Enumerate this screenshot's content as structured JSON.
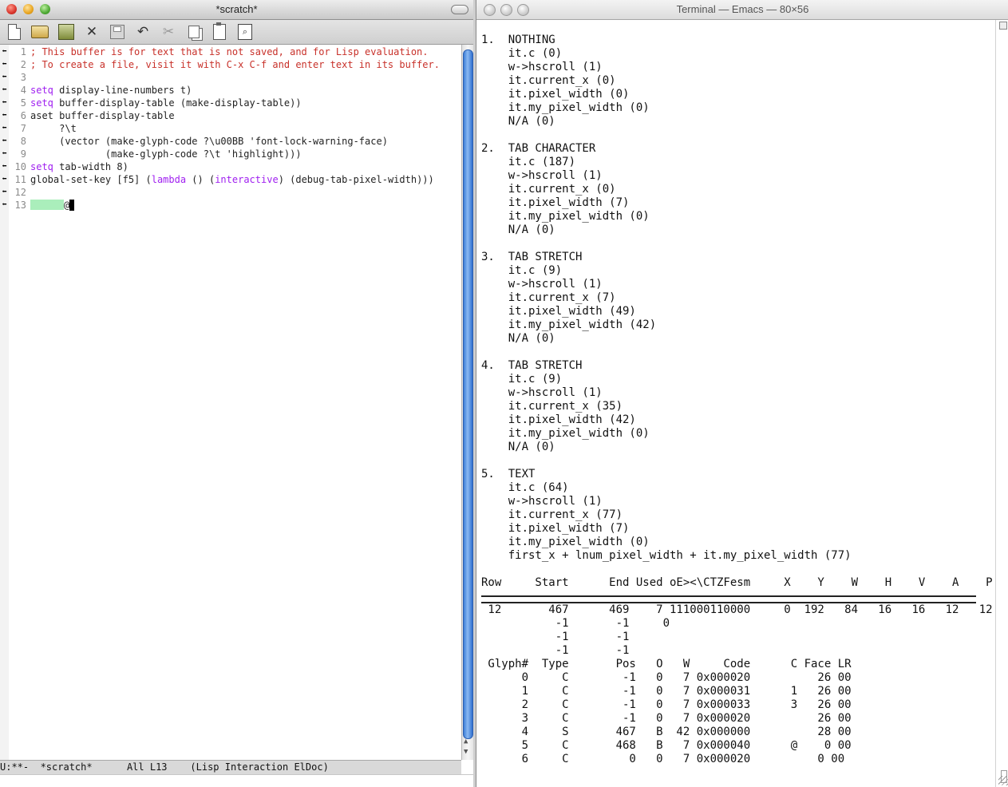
{
  "emacs": {
    "title": "*scratch*",
    "toolbar": {
      "new": "new-file-icon",
      "open": "open-folder-icon",
      "dired": "dired-icon",
      "kill": "✕",
      "save": "save-icon",
      "undo": "↶",
      "cut": "✂",
      "copy": "copy-icon",
      "paste": "paste-icon",
      "search": "⌕"
    },
    "lines": [
      {
        "n": "1",
        "segs": [
          {
            "t": "; This buffer is for text that is not saved, and for Lisp evaluation.",
            "c": "cmt"
          }
        ]
      },
      {
        "n": "2",
        "segs": [
          {
            "t": "; To create a file, visit it with C-x C-f and enter text in its buffer.",
            "c": "cmt"
          }
        ]
      },
      {
        "n": "3",
        "segs": []
      },
      {
        "n": "4",
        "segs": [
          {
            "t": "setq",
            "c": "kw"
          },
          {
            "t": " display-line-numbers t)",
            "c": ""
          }
        ]
      },
      {
        "n": "5",
        "segs": [
          {
            "t": "setq",
            "c": "kw"
          },
          {
            "t": " buffer-display-table (make-display-table))",
            "c": ""
          }
        ]
      },
      {
        "n": "6",
        "segs": [
          {
            "t": "aset buffer-display-table",
            "c": ""
          }
        ]
      },
      {
        "n": "7",
        "segs": [
          {
            "t": "     ?\\t",
            "c": ""
          }
        ]
      },
      {
        "n": "8",
        "segs": [
          {
            "t": "     (vector (make-glyph-code ?\\u00BB 'font-lock-warning-face)",
            "c": ""
          }
        ]
      },
      {
        "n": "9",
        "segs": [
          {
            "t": "             (make-glyph-code ?\\t 'highlight)))",
            "c": ""
          }
        ]
      },
      {
        "n": "10",
        "segs": [
          {
            "t": "setq",
            "c": "kw"
          },
          {
            "t": " tab-width 8)",
            "c": ""
          }
        ]
      },
      {
        "n": "11",
        "segs": [
          {
            "t": "global-set-key [f5] (",
            "c": ""
          },
          {
            "t": "lambda",
            "c": "kw"
          },
          {
            "t": " () (",
            "c": ""
          },
          {
            "t": "interactive",
            "c": "kw"
          },
          {
            "t": ") (debug-tab-pixel-width)))",
            "c": ""
          }
        ]
      },
      {
        "n": "12",
        "segs": []
      },
      {
        "n": "13",
        "segs": [],
        "tab": true,
        "after": "@"
      }
    ],
    "fringe_glyph": "⬅",
    "modeline": "U:**-  *scratch*      All L13    (Lisp Interaction ElDoc)"
  },
  "terminal": {
    "title": "Terminal — Emacs — 80×56",
    "lines": [
      "",
      "1.  NOTHING",
      "    it.c (0)",
      "    w->hscroll (1)",
      "    it.current_x (0)",
      "    it.pixel_width (0)",
      "    it.my_pixel_width (0)",
      "    N/A (0)",
      "",
      "2.  TAB CHARACTER",
      "    it.c (187)",
      "    w->hscroll (1)",
      "    it.current_x (0)",
      "    it.pixel_width (7)",
      "    it.my_pixel_width (0)",
      "    N/A (0)",
      "",
      "3.  TAB STRETCH",
      "    it.c (9)",
      "    w->hscroll (1)",
      "    it.current_x (7)",
      "    it.pixel_width (49)",
      "    it.my_pixel_width (42)",
      "    N/A (0)",
      "",
      "4.  TAB STRETCH",
      "    it.c (9)",
      "    w->hscroll (1)",
      "    it.current_x (35)",
      "    it.pixel_width (42)",
      "    it.my_pixel_width (0)",
      "    N/A (0)",
      "",
      "5.  TEXT",
      "    it.c (64)",
      "    w->hscroll (1)",
      "    it.current_x (77)",
      "    it.pixel_width (7)",
      "    it.my_pixel_width (0)",
      "    first_x + lnum_pixel_width + it.my_pixel_width (77)",
      "",
      "Row     Start      End Used oE><\\CTZFesm     X    Y    W    H    V    A    P",
      "",
      " 12       467      469    7 111000110000     0  192   84   16   16   12   12",
      "           -1       -1     0",
      "           -1       -1",
      "           -1       -1",
      " Glyph#  Type       Pos   O   W     Code      C Face LR",
      "      0     C        -1   0   7 0x000020          26 00",
      "      1     C        -1   0   7 0x000031      1   26 00",
      "      2     C        -1   0   7 0x000033      3   26 00",
      "      3     C        -1   0   7 0x000020          26 00",
      "      4     S       467   B  42 0x000000          28 00",
      "      5     C       468   B   7 0x000040      @    0 00",
      "      6     C         0   0   7 0x000020          0 00"
    ]
  }
}
